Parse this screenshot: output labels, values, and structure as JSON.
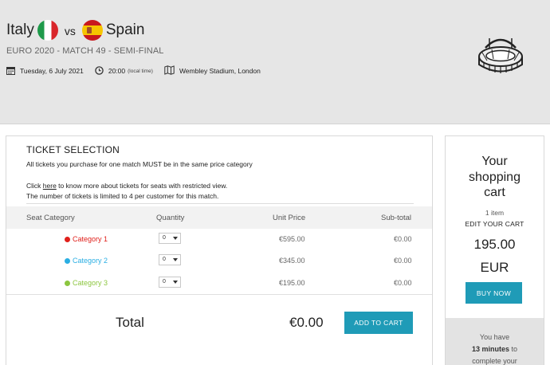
{
  "match": {
    "home_team": "Italy",
    "vs": "vs",
    "away_team": "Spain",
    "subtitle": "EURO 2020  - MATCH 49 - SEMI-FINAL",
    "date": "Tuesday, 6 July 2021",
    "time": "20:00",
    "time_note": "(local time)",
    "venue": "Wembley Stadium, London",
    "icons": [
      "calendar-icon",
      "clock-icon",
      "map-icon",
      "stadium-icon"
    ]
  },
  "tickets": {
    "title": "TICKET SELECTION",
    "notice": "All tickets you purchase for one match MUST be in the same price category",
    "restricted_prefix": "Click ",
    "restricted_link": "here",
    "restricted_suffix": " to know more about tickets for seats with restricted view.",
    "limit_note": "The number of tickets is limited to 4 per customer for this match.",
    "columns": {
      "category": "Seat Category",
      "quantity": "Quantity",
      "unit_price": "Unit Price",
      "subtotal": "Sub-total"
    },
    "rows": [
      {
        "category": "Category 1",
        "color": "#e0201b",
        "quantity": "0",
        "unit_price": "€595.00",
        "subtotal": "€0.00"
      },
      {
        "category": "Category 2",
        "color": "#2aaee3",
        "quantity": "0",
        "unit_price": "€345.00",
        "subtotal": "€0.00"
      },
      {
        "category": "Category 3",
        "color": "#8cc63f",
        "quantity": "0",
        "unit_price": "€195.00",
        "subtotal": "€0.00"
      }
    ],
    "total_label": "Total",
    "total_value": "€0.00",
    "add_to_cart": "ADD TO CART"
  },
  "cart": {
    "title_line1": "Your",
    "title_line2": "shopping",
    "title_line3": "cart",
    "item_count": "1 item",
    "edit": "EDIT YOUR CART",
    "amount": "195.00",
    "currency": "EUR",
    "buy_now": "BUY NOW",
    "timer_line1": "You have",
    "timer_minutes": "13 minutes",
    "timer_line2_suffix": " to",
    "timer_line3": "complete your"
  },
  "colors": {
    "accent": "#1f9bb7",
    "header_bg": "#e6e6e6"
  }
}
